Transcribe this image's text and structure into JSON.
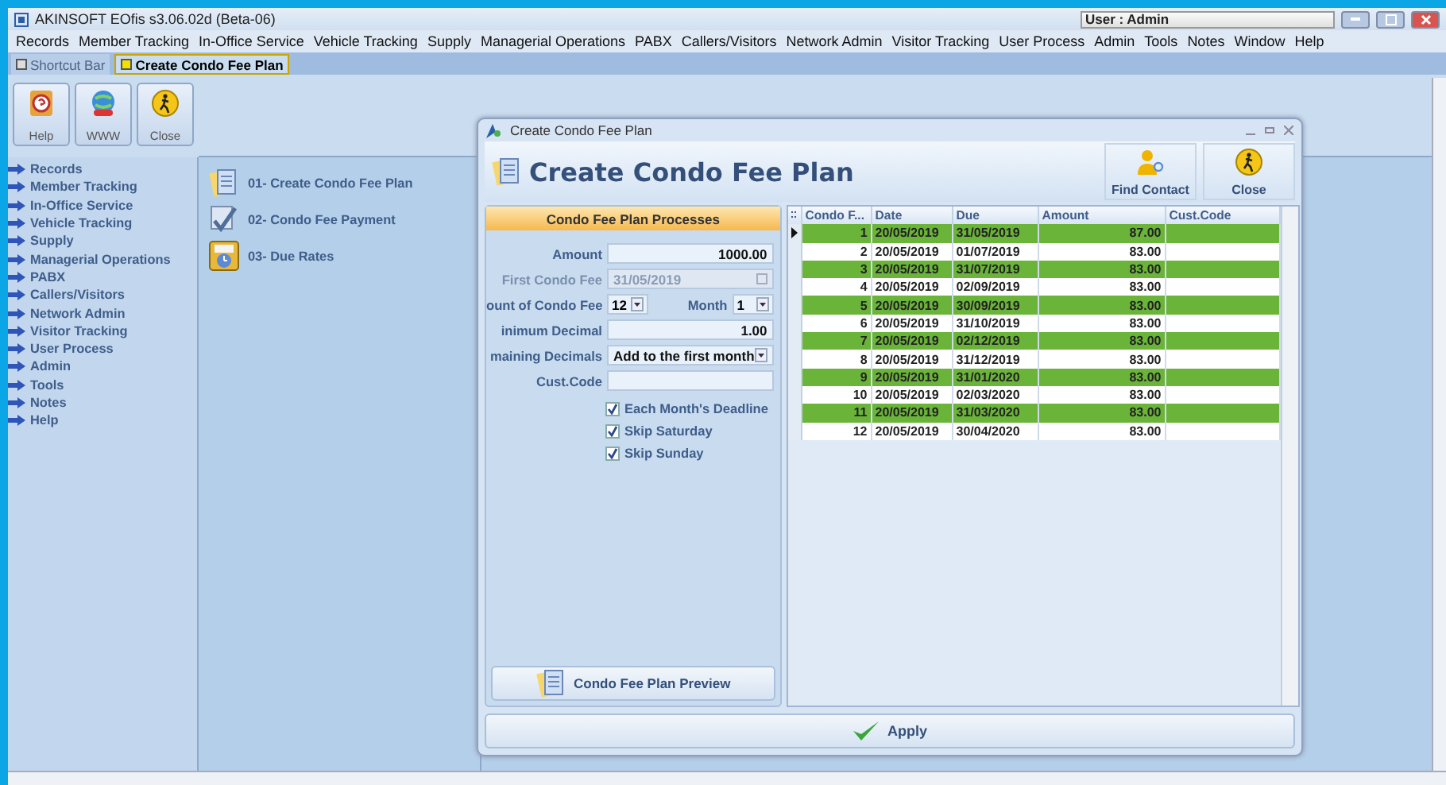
{
  "window": {
    "title": "AKINSOFT EOfis s3.06.02d (Beta-06)",
    "user": "User : Admin"
  },
  "menu": [
    "Records",
    "Member Tracking",
    "In-Office Service",
    "Vehicle Tracking",
    "Supply",
    "Managerial Operations",
    "PABX",
    "Callers/Visitors",
    "Network Admin",
    "Visitor Tracking",
    "User Process",
    "Admin",
    "Tools",
    "Notes",
    "Window",
    "Help"
  ],
  "tabs": [
    {
      "label": "Shortcut Bar",
      "selected": false
    },
    {
      "label": "Create Condo Fee Plan",
      "selected": true
    }
  ],
  "toolbar": [
    {
      "kind": "help",
      "label": "Help"
    },
    {
      "kind": "web",
      "label": "WWW"
    },
    {
      "kind": "close",
      "label": "Close"
    }
  ],
  "sidebar": {
    "items": [
      "Records",
      "Member Tracking",
      "In-Office Service",
      "Vehicle Tracking",
      "Supply",
      "Managerial Operations",
      "PABX",
      "Callers/Visitors",
      "Network Admin",
      "Visitor Tracking",
      "User Process",
      "Admin",
      "Tools",
      "Notes",
      "Help"
    ]
  },
  "shortcuts": [
    {
      "kind": "plan",
      "label": "01- Create Condo Fee Plan"
    },
    {
      "kind": "payment",
      "label": "02- Condo Fee Payment"
    },
    {
      "kind": "rates",
      "label": "03- Due Rates"
    }
  ],
  "dialog": {
    "title": "Create Condo Fee Plan",
    "heading": "Create Condo Fee Plan",
    "actions": [
      {
        "kind": "contact",
        "label": "Find Contact"
      },
      {
        "kind": "close",
        "label": "Close"
      }
    ],
    "panel_title": "Condo Fee Plan Processes",
    "fields": [
      {
        "kind": "text",
        "label": "Amount",
        "value": "1000.00",
        "disabled": false
      },
      {
        "kind": "date",
        "label": "First Condo Fee",
        "value": "31/05/2019",
        "disabled": true
      },
      {
        "kind": "pair",
        "label": "ount of Condo Fee",
        "value": "12",
        "second_label": "Month",
        "second_value": "1",
        "disabled": false
      },
      {
        "kind": "text",
        "label": "inimum Decimal",
        "value": "1.00",
        "disabled": false
      },
      {
        "kind": "select",
        "label": "maining Decimals",
        "value": "Add to the first month",
        "disabled": false
      },
      {
        "kind": "text",
        "label": "Cust.Code",
        "disabled": false
      }
    ],
    "checkboxes": [
      {
        "label": "Each Month's Deadline",
        "checked": true
      },
      {
        "label": "Skip Saturday",
        "checked": true
      },
      {
        "label": "Skip Sunday",
        "checked": true
      }
    ],
    "preview_button": "Condo Fee Plan Preview",
    "table": {
      "columns": [
        "Condo F...",
        "Date",
        "Due",
        "Amount",
        "Cust.Code"
      ],
      "rows": [
        {
          "cells": [
            "1",
            "20/05/2019",
            "31/05/2019",
            "87.00"
          ],
          "highlighted": true,
          "selected": true
        },
        {
          "cells": [
            "2",
            "20/05/2019",
            "01/07/2019",
            "83.00"
          ],
          "highlighted": false,
          "selected": false
        },
        {
          "cells": [
            "3",
            "20/05/2019",
            "31/07/2019",
            "83.00"
          ],
          "highlighted": true,
          "selected": false
        },
        {
          "cells": [
            "4",
            "20/05/2019",
            "02/09/2019",
            "83.00"
          ],
          "highlighted": false,
          "selected": false
        },
        {
          "cells": [
            "5",
            "20/05/2019",
            "30/09/2019",
            "83.00"
          ],
          "highlighted": true,
          "selected": false
        },
        {
          "cells": [
            "6",
            "20/05/2019",
            "31/10/2019",
            "83.00"
          ],
          "highlighted": false,
          "selected": false
        },
        {
          "cells": [
            "7",
            "20/05/2019",
            "02/12/2019",
            "83.00"
          ],
          "highlighted": true,
          "selected": false
        },
        {
          "cells": [
            "8",
            "20/05/2019",
            "31/12/2019",
            "83.00"
          ],
          "highlighted": false,
          "selected": false
        },
        {
          "cells": [
            "9",
            "20/05/2019",
            "31/01/2020",
            "83.00"
          ],
          "highlighted": true,
          "selected": false
        },
        {
          "cells": [
            "10",
            "20/05/2019",
            "02/03/2020",
            "83.00"
          ],
          "highlighted": false,
          "selected": false
        },
        {
          "cells": [
            "11",
            "20/05/2019",
            "31/03/2020",
            "83.00"
          ],
          "highlighted": true,
          "selected": false
        },
        {
          "cells": [
            "12",
            "20/05/2019",
            "30/04/2020",
            "83.00"
          ],
          "highlighted": false,
          "selected": false
        }
      ]
    },
    "apply_button": "Apply"
  }
}
